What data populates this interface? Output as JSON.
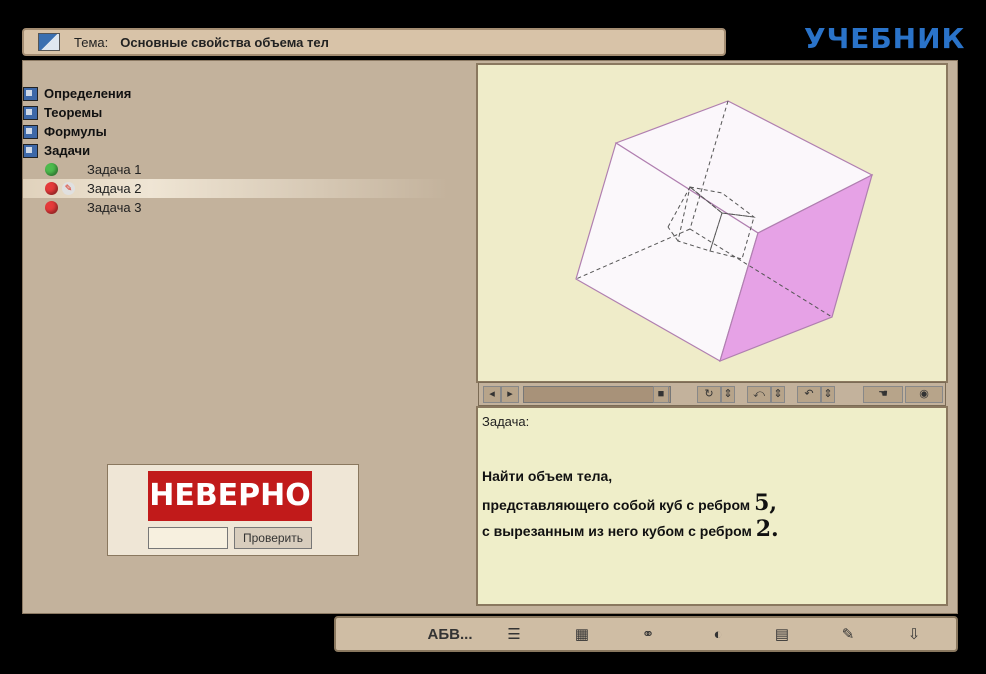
{
  "window": {
    "label": "Тема:",
    "title": "Основные свойства объема тел"
  },
  "brand": "УЧЕБНИК",
  "tree": {
    "items": [
      {
        "label": "Определения"
      },
      {
        "label": "Теоремы"
      },
      {
        "label": "Формулы"
      },
      {
        "label": "Задачи"
      }
    ],
    "tasks": [
      {
        "label": "Задача 1",
        "status": "green"
      },
      {
        "label": "Задача 2",
        "status": "red",
        "selected": true
      },
      {
        "label": "Задача 3",
        "status": "red"
      }
    ]
  },
  "check": {
    "verdict": "НЕВЕРНО",
    "button_label": "Проверить",
    "answer_value": ""
  },
  "task": {
    "heading": "Задача:",
    "line1": "Найти объем тела,",
    "line2": "представляющего собой куб с ребром",
    "value1": "5,",
    "line3": "с вырезанным из него кубом с ребром",
    "value2": "2."
  },
  "toolbar": {
    "abc_label": "АБВ..."
  },
  "colors": {
    "verdict": "#c11a1a",
    "brand": "#2a73c9",
    "cube_face": "#e6a2e6"
  },
  "icons": [
    "book-icon",
    "rotate-icon",
    "zoom-icon",
    "reset-icon",
    "hand-icon",
    "eye-icon",
    "sliders-icon",
    "chart-icon",
    "binoculars-icon",
    "color-icon",
    "image-icon",
    "notes-icon",
    "exit-icon"
  ]
}
